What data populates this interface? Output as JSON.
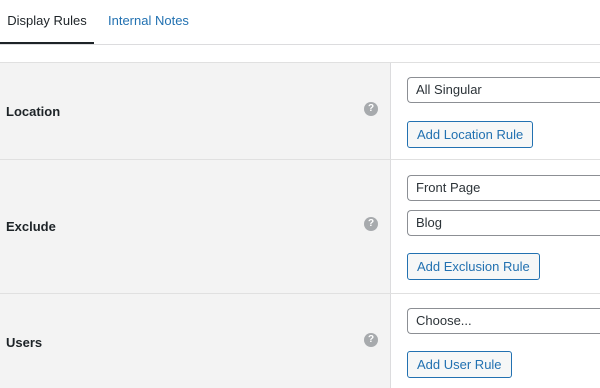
{
  "tabs": [
    {
      "label": "Display Rules",
      "active": true
    },
    {
      "label": "Internal Notes",
      "active": false
    }
  ],
  "help_glyph": "?",
  "rows": [
    {
      "label": "Location",
      "selects": [
        "All Singular"
      ],
      "button": "Add Location Rule"
    },
    {
      "label": "Exclude",
      "selects": [
        "Front Page",
        "Blog"
      ],
      "button": "Add Exclusion Rule"
    },
    {
      "label": "Users",
      "selects": [
        "Choose..."
      ],
      "button": "Add User Rule"
    }
  ],
  "colors": {
    "link": "#2271b1",
    "label_bg": "#f3f3f3",
    "help_icon": "#a7aaad"
  }
}
